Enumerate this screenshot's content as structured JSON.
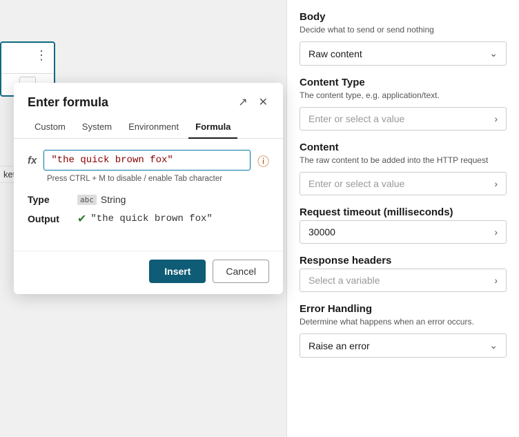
{
  "dialog": {
    "title": "Enter formula",
    "expand_icon": "↗",
    "close_icon": "✕",
    "tabs": [
      {
        "id": "custom",
        "label": "Custom",
        "active": false
      },
      {
        "id": "system",
        "label": "System",
        "active": false
      },
      {
        "id": "environment",
        "label": "Environment",
        "active": false
      },
      {
        "id": "formula",
        "label": "Formula",
        "active": true
      }
    ],
    "fx_label": "fx",
    "formula_value": "\"the quick brown fox\"",
    "hint": "Press CTRL + M to disable / enable Tab character",
    "type_label": "Type",
    "type_icon": "abc",
    "type_value": "String",
    "output_label": "Output",
    "output_value": "\"the quick brown fox\"",
    "insert_button": "Insert",
    "cancel_button": "Cancel"
  },
  "right_panel": {
    "body_title": "Body",
    "body_subtitle": "Decide what to send or send nothing",
    "body_dropdown": "Raw content",
    "content_type_title": "Content Type",
    "content_type_subtitle": "The content type, e.g. application/text.",
    "content_type_placeholder": "Enter or select a value",
    "content_title": "Content",
    "content_subtitle": "The raw content to be added into the HTTP request",
    "content_placeholder": "Enter or select a value",
    "timeout_title": "Request timeout (milliseconds)",
    "timeout_value": "30000",
    "response_title": "Response headers",
    "response_placeholder": "Select a variable",
    "error_title": "Error Handling",
    "error_subtitle": "Determine what happens when an error occurs.",
    "error_dropdown": "Raise an error"
  },
  "canvas": {
    "dots": "⋮",
    "arrow": "›",
    "ket_label": "ket"
  }
}
